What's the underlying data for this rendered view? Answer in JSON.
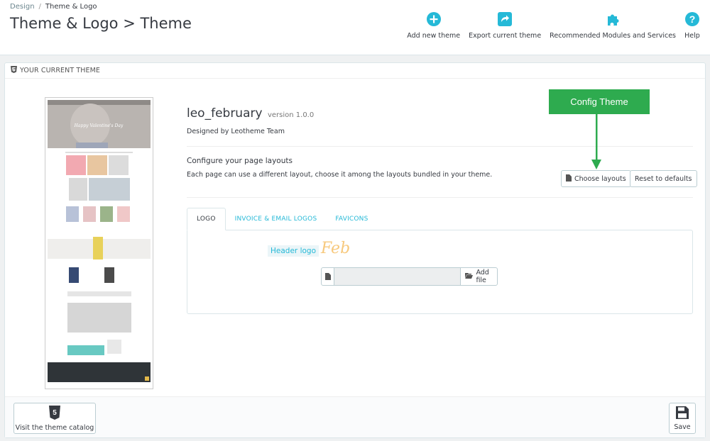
{
  "breadcrumb": {
    "parent": "Design",
    "current": "Theme & Logo"
  },
  "page": {
    "title": "Theme & Logo > Theme"
  },
  "toolbar": {
    "add_theme": "Add new theme",
    "export_theme": "Export current theme",
    "recommended": "Recommended Modules and Services",
    "help": "Help"
  },
  "panel": {
    "heading": "YOUR CURRENT THEME"
  },
  "theme": {
    "name": "leo_february",
    "version": "version 1.0.0",
    "designed_by": "Designed by Leotheme Team",
    "preview_banner": "Happy Valentine's Day"
  },
  "layouts": {
    "title": "Configure your page layouts",
    "description": "Each page can use a different layout, choose it among the layouts bundled in your theme.",
    "choose_label": "Choose layouts",
    "reset_label": "Reset to defaults"
  },
  "annotation": {
    "config_theme": "Config Theme"
  },
  "tabs": [
    {
      "label": "LOGO",
      "active": true
    },
    {
      "label": "INVOICE & EMAIL LOGOS",
      "active": false
    },
    {
      "label": "FAVICONS",
      "active": false
    }
  ],
  "logo_tab": {
    "header_logo_label": "Header logo",
    "logo_text": "Feb",
    "add_file_label": "Add file",
    "file_value": ""
  },
  "footer": {
    "catalog_label": "Visit the theme catalog",
    "save_label": "Save"
  },
  "colors": {
    "accent": "#25b9d7",
    "annotation_green": "#2eab4f"
  }
}
